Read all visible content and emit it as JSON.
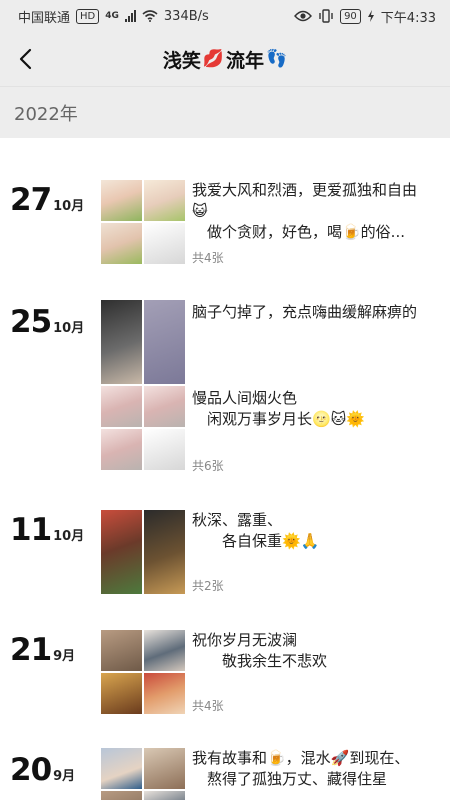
{
  "status_bar": {
    "carrier": "中国联通",
    "hd": "HD",
    "network": "4G",
    "speed": "334B/s",
    "battery": "90",
    "time": "下午4:33"
  },
  "header": {
    "back_icon": "chevron-left-icon",
    "title_prefix": "浅笑",
    "title_emoji_lips": "💋",
    "title_suffix": "流年",
    "title_emoji_feet": "👣"
  },
  "year_label": "2022年",
  "entries": [
    {
      "day": "27",
      "month": "10月",
      "lines": [
        "我爱大风和烈酒，更爱孤独和自由",
        "😺",
        "　做个贪财，好色，喝🍺的俗..."
      ],
      "count": "共4张"
    },
    {
      "day": "25",
      "month": "10月",
      "lines": [
        "脑子勺掉了，充点嗨曲缓解麻痹的",
        "慢品人间烟火色",
        "　闲观万事岁月长🌝🐱🌞"
      ],
      "count": "共6张"
    },
    {
      "day": "11",
      "month": "10月",
      "lines": [
        "秋深、露重、",
        "　　各自保重🌞🙏"
      ],
      "count": "共2张"
    },
    {
      "day": "21",
      "month": "9月",
      "lines": [
        "祝你岁月无波澜",
        "　　敬我余生不悲欢"
      ],
      "count": "共4张"
    },
    {
      "day": "20",
      "month": "9月",
      "lines": [
        "我有故事和🍺，混水🚀到现在、",
        "　熬得了孤独万丈、藏得住星"
      ],
      "count": ""
    }
  ]
}
